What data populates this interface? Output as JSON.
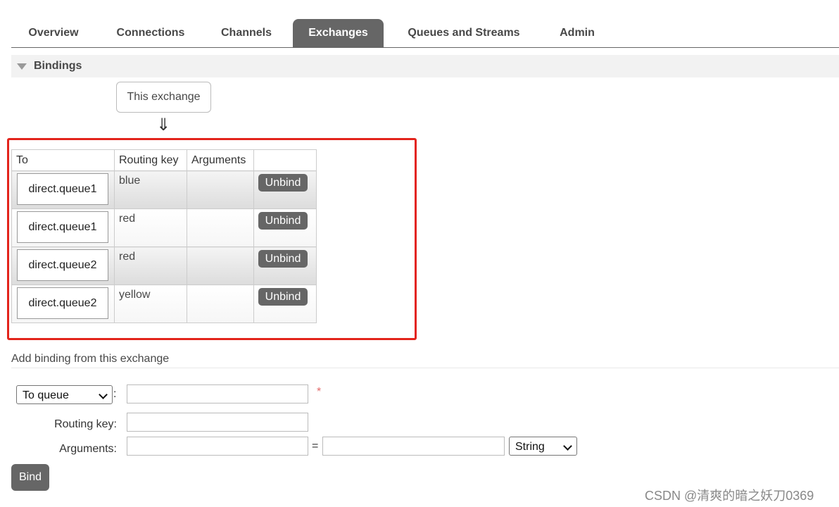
{
  "tabs": [
    "Overview",
    "Connections",
    "Channels",
    "Exchanges",
    "Queues and Streams",
    "Admin"
  ],
  "active_tab": "Exchanges",
  "section": {
    "title": "Bindings"
  },
  "this_exchange_label": "This exchange",
  "arrow": "⇓",
  "table": {
    "headers": [
      "To",
      "Routing key",
      "Arguments",
      ""
    ],
    "rows": [
      {
        "to": "direct.queue1",
        "routing_key": "blue",
        "arguments": "",
        "action": "Unbind"
      },
      {
        "to": "direct.queue1",
        "routing_key": "red",
        "arguments": "",
        "action": "Unbind"
      },
      {
        "to": "direct.queue2",
        "routing_key": "red",
        "arguments": "",
        "action": "Unbind"
      },
      {
        "to": "direct.queue2",
        "routing_key": "yellow",
        "arguments": "",
        "action": "Unbind"
      }
    ]
  },
  "add_binding": {
    "title": "Add binding from this exchange",
    "destination_type": "To queue",
    "colon": ":",
    "required_marker": "*",
    "routing_key_label": "Routing key:",
    "arguments_label": "Arguments:",
    "equals": "=",
    "argument_type": "String",
    "bind_label": "Bind"
  },
  "watermark": "CSDN @清爽的暗之妖刀0369"
}
